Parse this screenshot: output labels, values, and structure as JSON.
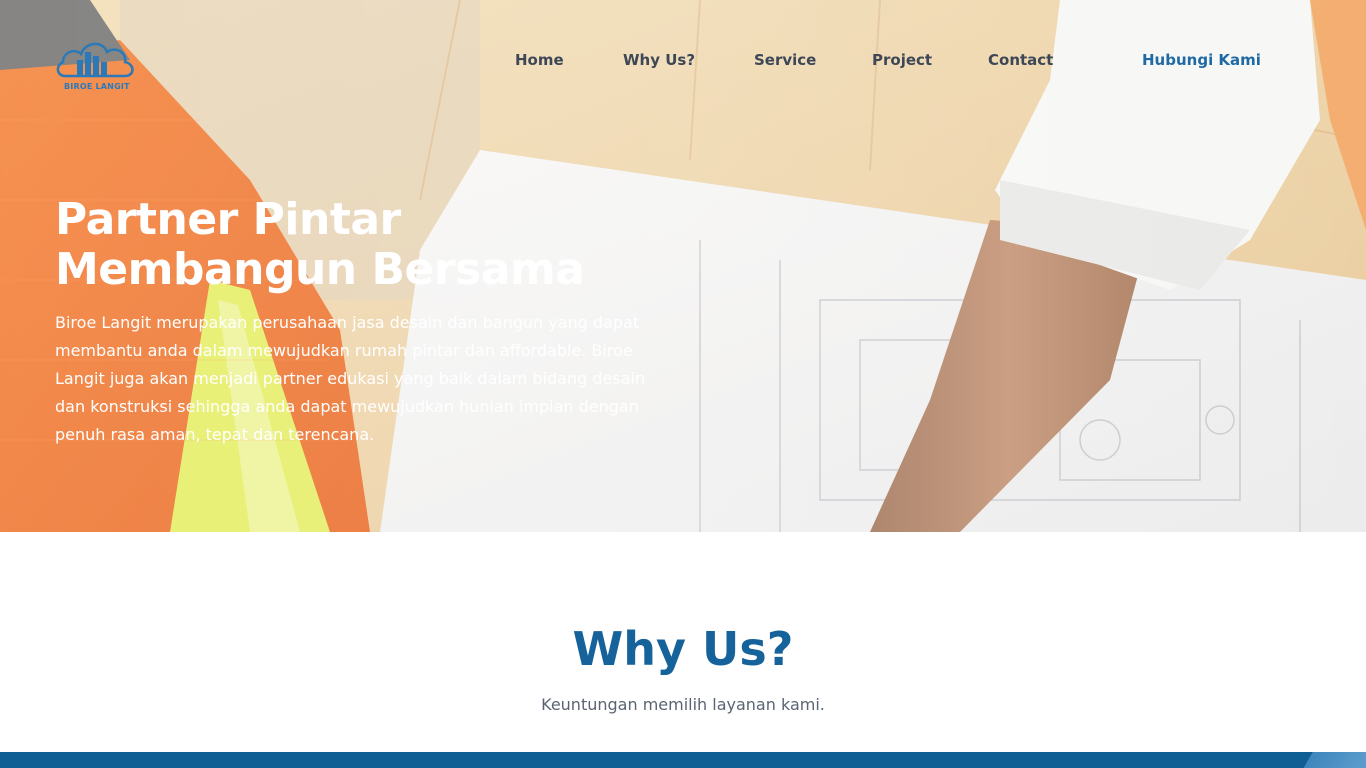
{
  "brand": {
    "logo_text": "BIROE LANGIT"
  },
  "nav": {
    "items": [
      {
        "label": "Home"
      },
      {
        "label": "Why Us?"
      },
      {
        "label": "Service"
      },
      {
        "label": "Project"
      },
      {
        "label": "Contact"
      }
    ],
    "cta_label": "Hubungi Kami"
  },
  "hero": {
    "title_line1": "Partner Pintar",
    "title_line2": "Membangun Bersama",
    "description": "Biroe Langit merupakan perusahaan jasa desain dan bangun yang dapat membantu anda dalam mewujudkan rumah pintar dan affordable. Biroe Langit juga akan menjadi partner edukasi yang baik dalam bidang desain dan konstruksi sehingga anda dapat mewujudkan hunian impian dengan penuh rasa aman, tepat dan terencana."
  },
  "why_us": {
    "title": "Why Us?",
    "subtitle": "Keuntungan memilih layanan kami."
  },
  "colors": {
    "primary": "#16629a",
    "nav_text": "#3d4756",
    "band": "#0f5f94",
    "vest_orange": "#f26a1f",
    "vest_stripe": "#d9e84a"
  },
  "icons": {
    "logo": "cloud-buildings-logo"
  }
}
